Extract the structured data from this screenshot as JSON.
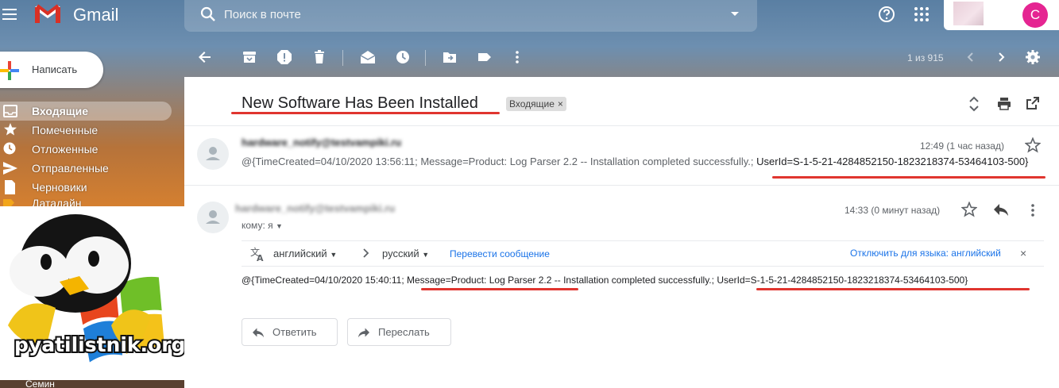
{
  "app": {
    "name": "Gmail"
  },
  "search": {
    "placeholder": "Поиск в почте"
  },
  "account": {
    "initial": "С"
  },
  "compose": {
    "label": "Написать"
  },
  "sidebar": {
    "items": [
      {
        "label": "Входящие",
        "icon": "inbox-icon",
        "active": true
      },
      {
        "label": "Помеченные",
        "icon": "star-icon",
        "active": false
      },
      {
        "label": "Отложенные",
        "icon": "clock-icon",
        "active": false
      },
      {
        "label": "Отправленные",
        "icon": "send-icon",
        "active": false
      },
      {
        "label": "Черновики",
        "icon": "draft-icon",
        "active": false
      },
      {
        "label": "Датадайн",
        "icon": "label-icon",
        "active": false
      }
    ],
    "user": "Семин"
  },
  "watermark": {
    "text": "pyatilistnik.org"
  },
  "toolbar": {
    "page_count": "1 из 915"
  },
  "thread": {
    "subject": "New Software Has Been Installed",
    "label": "Входящие",
    "label_close": "×",
    "messages": [
      {
        "sender": "hardware_notify@testvampiki.ru",
        "time": "12:49 (1 час назад)",
        "snippet_part1": "@{TimeCreated=04/10/2020 13:56:11; Message=Product: Log Parser 2.2 -- Installation completed successfully.; ",
        "snippet_part2": "UserId=S-1-5-21-4284852150-1823218374-53464103-500}"
      },
      {
        "sender": "hardware_notify@testvampiki.ru",
        "time": "14:33 (0 минут назад)",
        "recipient": "кому: я",
        "body_part1": "@{TimeCreated=04/10/2020 15:40:11; ",
        "body_part2": "Message=Product: Log Parser 2.2",
        "body_part3": " -- Installation completed successfully.; ",
        "body_part4": "UserId=S-1-5-21-4284852150-1823218374-53464103-500}"
      }
    ]
  },
  "translate": {
    "from": "английский",
    "to": "русский",
    "translate_link": "Перевести сообщение",
    "disable_link": "Отключить для языка: английский",
    "close": "×"
  },
  "actions": {
    "reply": "Ответить",
    "forward": "Переслать"
  },
  "colors": {
    "accent_red": "#e0352f",
    "link_blue": "#1a73e8",
    "avatar_pink": "#e52592"
  }
}
